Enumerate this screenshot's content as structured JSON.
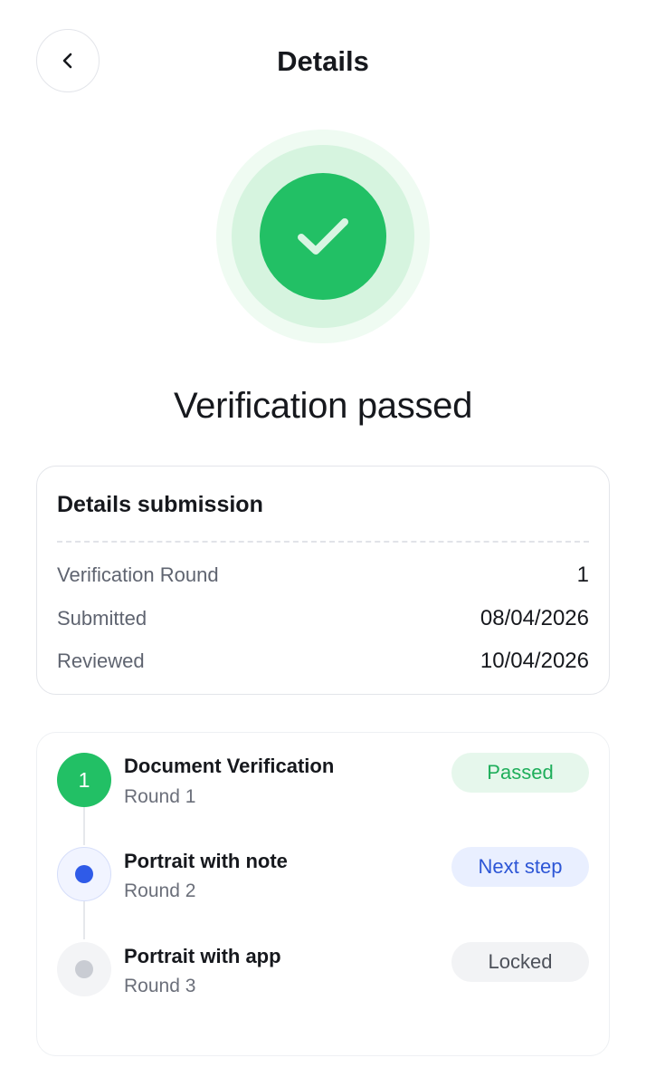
{
  "header": {
    "title": "Details"
  },
  "result": {
    "title": "Verification passed"
  },
  "details": {
    "title": "Details submission",
    "rows": [
      {
        "label": "Verification Round",
        "value": "1"
      },
      {
        "label": "Submitted",
        "value": "08/04/2026"
      },
      {
        "label": "Reviewed",
        "value": "10/04/2026"
      }
    ]
  },
  "steps": [
    {
      "number": "1",
      "title": "Document Verification",
      "subtitle": "Round 1",
      "status": "Passed",
      "state": "done"
    },
    {
      "title": "Portrait with note",
      "subtitle": "Round 2",
      "status": "Next step",
      "state": "next"
    },
    {
      "title": "Portrait with app",
      "subtitle": "Round 3",
      "status": "Locked",
      "state": "locked"
    }
  ],
  "icons": {
    "back": "chevron-left-icon",
    "success": "checkmark-icon"
  },
  "colors": {
    "success": "#22c065",
    "accent_blue": "#2f5be8",
    "locked": "#c9ccd3"
  }
}
